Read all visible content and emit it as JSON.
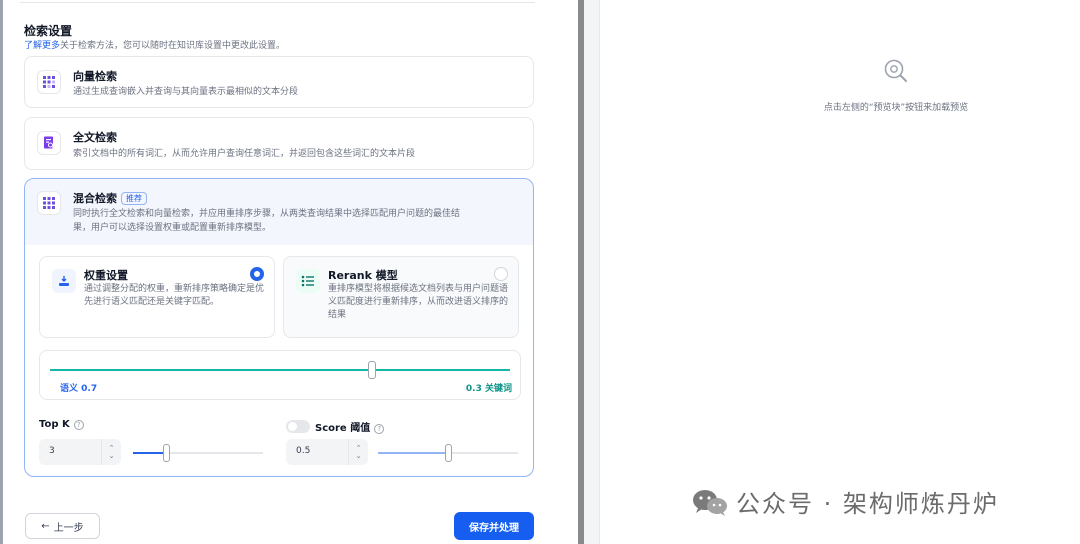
{
  "retrieval": {
    "title": "检索设置",
    "desc_link": "了解更多",
    "desc_rest": "关于检索方法，您可以随时在知识库设置中更改此设置。"
  },
  "vector": {
    "title": "向量检索",
    "desc": "通过生成查询嵌入并查询与其向量表示最相似的文本分段"
  },
  "fulltext": {
    "title": "全文检索",
    "desc": "索引文档中的所有词汇，从而允许用户查询任意词汇，并返回包含这些词汇的文本片段"
  },
  "hybrid": {
    "title": "混合检索",
    "badge": "推荐",
    "desc_line1": "同时执行全文检索和向量检索，并应用重排序步骤，从两类查询结果中选择匹配用户问题的最佳结",
    "desc_line2": "果，用户可以选择设置权重或配置重新排序模型。",
    "weight": {
      "title": "权重设置",
      "desc": "通过调整分配的权重，重新排序策略确定是优先进行语义匹配还是关键字匹配。",
      "selected": true
    },
    "rerank": {
      "title": "Rerank 模型",
      "desc": "重排序模型将根据候选文档列表与用户问题语义匹配度进行重新排序，从而改进语义排序的结果",
      "selected": false
    },
    "slider": {
      "semantic_label": "语义 0.7",
      "keyword_label": "0.3 关键词",
      "semantic_weight": 0.7
    }
  },
  "topk": {
    "label": "Top K",
    "help": "?",
    "value": "3",
    "level": 0.25
  },
  "score": {
    "label": "Score 阈值",
    "help": "?",
    "enabled": false,
    "value": "0.5",
    "level": 0.5
  },
  "footer": {
    "back_label": "上一步",
    "back_arrow": "←",
    "save_label": "保存并处理"
  },
  "preview": {
    "hint": "点击左侧的“预览块”按钮来加载预览"
  },
  "watermark": {
    "text": "公众号 · 架构师炼丹炉"
  },
  "colors": {
    "primary": "#155eef",
    "teal": "#14b8a6",
    "border": "#e5e7eb"
  }
}
